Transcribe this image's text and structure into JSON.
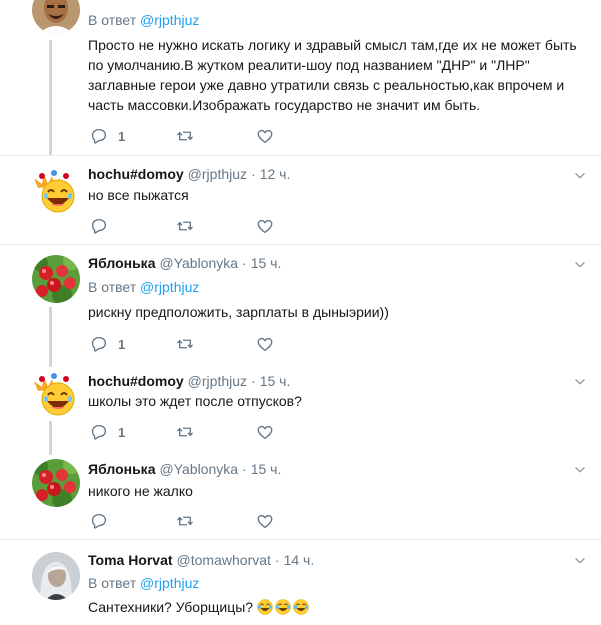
{
  "reply_prefix": "В ответ",
  "tweets": [
    {
      "name": "",
      "handle": "",
      "time": "",
      "reply_to": "@rjpthjuz",
      "text": "Просто не нужно искать логику и здравый смысл там,где их не может быть по умолчанию.В жутком реалити-шоу под названием \"ДНР\" и \"ЛНР\" заглавные герои уже давно утратили связь с реальностью,как впрочем и часть массовки.Изображать государство не значит им быть.",
      "reply_count": "1",
      "avatar_icon": "man-photo-avatar"
    },
    {
      "name": "hochu#domoy",
      "handle": "@rjpthjuz",
      "time": "12 ч.",
      "reply_to": "",
      "text": "но все пыжатся",
      "reply_count": "",
      "avatar_icon": "laughing-smiley-avatar"
    },
    {
      "name": "Яблонька",
      "handle": "@Yablonyka",
      "time": "15 ч.",
      "reply_to": "@rjpthjuz",
      "text": "рискну предположить, зарплаты в дыныэрии))",
      "reply_count": "1",
      "avatar_icon": "apple-tree-avatar"
    },
    {
      "name": "hochu#domoy",
      "handle": "@rjpthjuz",
      "time": "15 ч.",
      "reply_to": "",
      "text": "школы это ждет после отпусков?",
      "reply_count": "1",
      "avatar_icon": "laughing-smiley-avatar"
    },
    {
      "name": "Яблонька",
      "handle": "@Yablonyka",
      "time": "15 ч.",
      "reply_to": "",
      "text": "никого не жалко",
      "reply_count": "",
      "avatar_icon": "apple-tree-avatar"
    },
    {
      "name": "Toma Horvat",
      "handle": "@tomawhorvat",
      "time": "14 ч.",
      "reply_to": "@rjpthjuz",
      "text": "Сантехники? Уборщицы?",
      "reply_count": "",
      "avatar_icon": "woman-photo-avatar",
      "trailing_emoji": "face-with-tears-of-joy x3"
    }
  ],
  "colors": {
    "link": "#1da1f2",
    "secondary": "#657786",
    "text": "#14171a",
    "thread_line": "#ccd6dd",
    "divider": "#e6ecf0"
  }
}
